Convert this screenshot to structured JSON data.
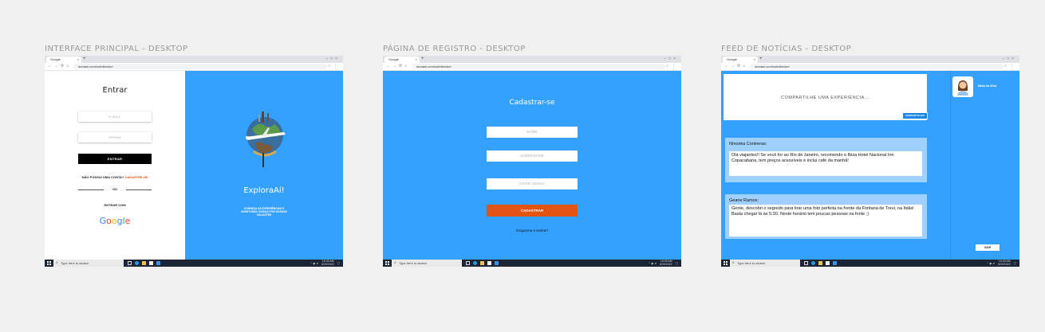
{
  "frames": {
    "f1": {
      "title": "INTERFACE PRINCIPAL - DESKTOP",
      "tab_label": "Google",
      "url": "domain.com/subdirectori",
      "login_title": "Entrar",
      "email_placeholder": "E-MAIL",
      "password_placeholder": "SENHA",
      "login_button": "ENTRAR",
      "no_account": "NÃO POSSUI UMA CONTA?",
      "signup_link": "CADASTRE-SE",
      "or": "OU",
      "sign_in_with": "ENTRAR COM",
      "brand": "ExploraAí!",
      "tagline": "CONHEÇA AS EXPERIÊNCIAS E AVENTURAS VIVIDAS POR NOSSOS VIAJANTES"
    },
    "f2": {
      "title": "PÁGINA DE REGISTRO - DESKTOP",
      "tab_label": "Google",
      "url": "domain.com/subdirectori",
      "heading": "Cadastrar-se",
      "name_placeholder": "NOME",
      "surname_placeholder": "SOBRENOME",
      "password_placeholder": "CRIAR SENHA",
      "submit_button": "CADASTRAR",
      "forgot": "Esqueceu a senha?"
    },
    "f3": {
      "title": "FEED DE NOTÍCIAS - DESKTOP",
      "tab_label": "Google",
      "url": "domain.com/subdirectori",
      "share_prompt": "COMPARTILHE UMA EXPERIÊNCIA...",
      "share_button": "COMPARTILHAR",
      "posts": [
        {
          "author": "Nínoska Contreras:",
          "text": "Olá viajantes!! Se você for ao Rio de Janeiro, recomendo o Ibiza Hotel Nacional Inn Copacabana, tem preços acessíveis e inclui café da manhã!"
        },
        {
          "author": "Geane Ramos:",
          "text": "Gente, descobri o segredo para tirar uma foto perfeita na frente da Fontana de Trevi, na Itália! Basta chegar lá às 5:30. Neste horário tem poucas pessoas na fonte ;)"
        }
      ],
      "user_name": "Maria da Silva",
      "exit_button": "SAIR"
    }
  },
  "taskbar": {
    "search_placeholder": "Type here to search",
    "time": "10:30 AM",
    "date": "6/20/2022"
  },
  "colors": {
    "primary_blue": "#35a1ff",
    "accent_orange": "#e35412",
    "post_bg": "#9fd0ff"
  }
}
